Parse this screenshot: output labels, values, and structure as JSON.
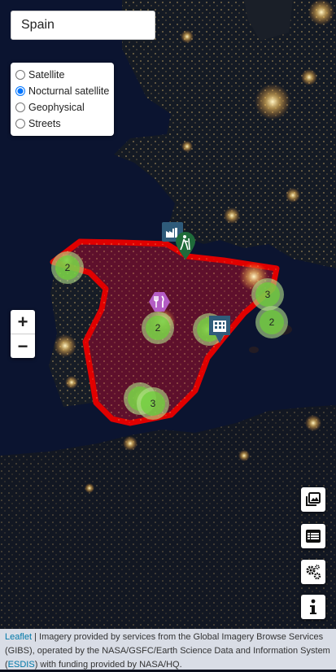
{
  "search": {
    "value": "Spain"
  },
  "layers": {
    "options": [
      "Satellite",
      "Nocturnal satellite",
      "Geophysical",
      "Streets"
    ],
    "selected": "Nocturnal satellite"
  },
  "zoom": {
    "in_label": "+",
    "out_label": "−"
  },
  "clusters": [
    {
      "count": "2"
    },
    {
      "count": "3"
    },
    {
      "count": "2"
    },
    {
      "count": "2"
    },
    {
      "count": ""
    },
    {
      "count": ""
    },
    {
      "count": "3"
    }
  ],
  "markers": [
    {
      "icon": "factory-icon",
      "color": "#2f5b7a"
    },
    {
      "icon": "hiking-icon",
      "color": "#1f6b3a"
    },
    {
      "icon": "restaurant-icon",
      "color": "#b45cc4"
    },
    {
      "icon": "building-icon",
      "color": "#2f5b7a"
    }
  ],
  "highlight": {
    "border_color": "#e00000",
    "fill_color": "#7a1030"
  },
  "side_buttons": [
    "image-gallery-icon",
    "list-icon",
    "settings-icon",
    "info-icon"
  ],
  "attribution": {
    "leaflet": "Leaflet",
    "sep": " | ",
    "text1": "Imagery provided by services from the Global Imagery Browse Services (GIBS), operated by the NASA/GSFC/Earth Science Data and Information System (",
    "esdis": "ESDIS",
    "text2": ") with funding provided by NASA/HQ."
  }
}
